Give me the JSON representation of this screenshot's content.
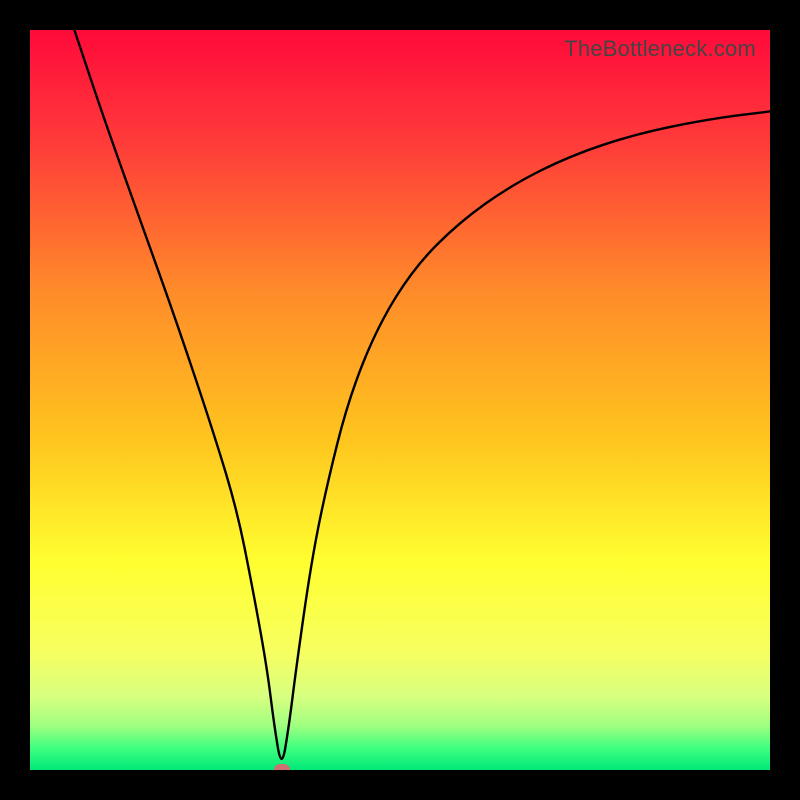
{
  "watermark": "TheBottleneck.com",
  "chart_data": {
    "type": "line",
    "title": "",
    "xlabel": "",
    "ylabel": "",
    "xlim": [
      0,
      100
    ],
    "ylim": [
      0,
      100
    ],
    "grid": false,
    "legend": false,
    "series": [
      {
        "name": "bottleneck-curve",
        "color": "#000000",
        "x": [
          6,
          10,
          15,
          20,
          25,
          28,
          30,
          32,
          33,
          34,
          35,
          36,
          38,
          40,
          43,
          47,
          52,
          58,
          65,
          73,
          82,
          92,
          100
        ],
        "values": [
          100,
          88,
          74,
          60,
          45,
          35,
          25,
          14,
          6,
          0,
          6,
          14,
          28,
          38,
          50,
          60,
          68,
          74,
          79,
          83,
          86,
          88,
          89
        ]
      }
    ],
    "markers": [
      {
        "name": "optimal-point",
        "x": 34,
        "y": 0,
        "color": "#cf6f73"
      }
    ],
    "background_gradient": {
      "type": "vertical",
      "stops": [
        {
          "pos": 0.0,
          "color": "#ff0a3a"
        },
        {
          "pos": 0.15,
          "color": "#ff3a3a"
        },
        {
          "pos": 0.35,
          "color": "#ff8a2a"
        },
        {
          "pos": 0.55,
          "color": "#ffc41e"
        },
        {
          "pos": 0.72,
          "color": "#ffff30"
        },
        {
          "pos": 0.84,
          "color": "#f7ff60"
        },
        {
          "pos": 0.9,
          "color": "#d8ff80"
        },
        {
          "pos": 0.94,
          "color": "#a0ff80"
        },
        {
          "pos": 0.97,
          "color": "#40ff80"
        },
        {
          "pos": 1.0,
          "color": "#00e878"
        }
      ]
    }
  }
}
